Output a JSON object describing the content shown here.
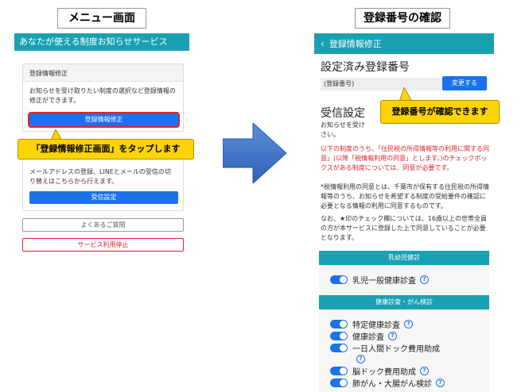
{
  "labels": {
    "menu_screen": "メニュー画面",
    "confirm_screen": "登録番号の確認"
  },
  "left": {
    "header": "あなたが使える制度お知らせサービス",
    "card1": {
      "title": "登録情報修正",
      "desc": "お知らせを受け取りたい制度の選択など登録情報の修正ができます。",
      "button": "登録情報修正"
    },
    "card2": {
      "desc": "メールアドレスの登録、LINEとメールの受信の切り替えはこちらから行えます。",
      "button": "受信設定"
    },
    "faq_button": "よくあるご質問",
    "stop_button": "サービス利用停止",
    "callout": "「登録情報修正画面」をタップします"
  },
  "right": {
    "header": "登録情報修正",
    "registered_title": "設定済み登録番号",
    "reg_number_label": "(登録番号)",
    "change_button": "変更する",
    "receive_title": "受信設定",
    "callout": "登録番号が確認できます",
    "intro_text_1": "お知らせを受け",
    "intro_text_2": "さい。",
    "red_text": "以下の制度のうち、「住民税の所得情報等の利用に関する同意」(以降「税情報利用の同意」とします。)のチェックボックスがある制度については、同意が必要です。",
    "note_text": "*税情報利用の同意とは、千葉市が保有する住民税の所得情報等のうち、お知らせを希望する制度の受給要件の確認に必要となる情報の利用に同意するものです。",
    "note_text_2": "なお、★印のチェック欄については、16歳以上の世帯全員の方が本サービスに登録した上で同意していることが必要となります。",
    "sections": [
      {
        "title": "乳幼児健診",
        "items": [
          "乳児一般健康診査"
        ]
      },
      {
        "title": "健康診査・がん検診",
        "items": [
          "特定健康診査",
          "健康診査",
          "一日人間ドック費用助成",
          "脳ドック費用助成",
          "肺がん・大腸がん検診"
        ]
      }
    ]
  },
  "colors": {
    "teal": "#19a1b3",
    "blue": "#1a73e8",
    "red": "#e0232b",
    "yellow": "#ffd400"
  }
}
